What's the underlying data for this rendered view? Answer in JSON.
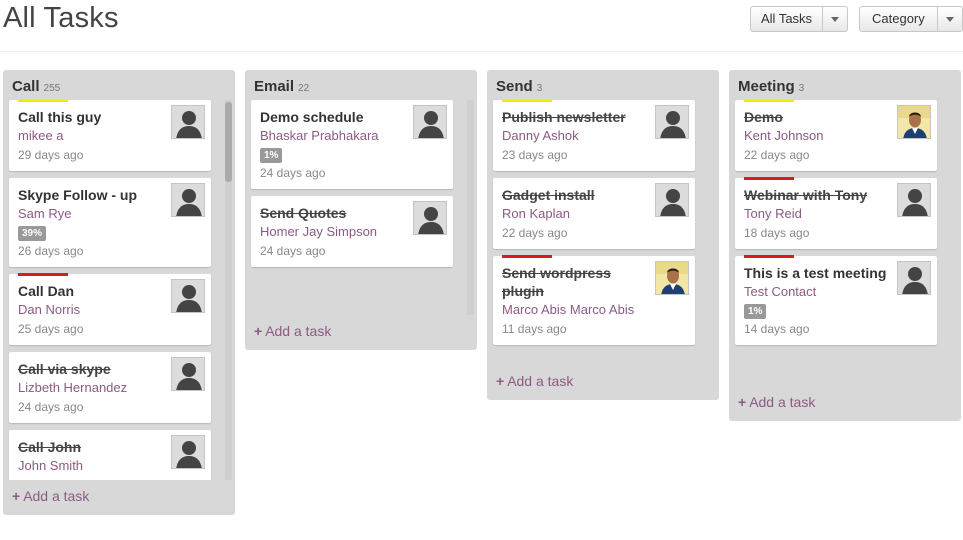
{
  "page": {
    "title": "All Tasks"
  },
  "filters": {
    "all_tasks_label": "All Tasks",
    "category_label": "Category"
  },
  "add_task_label": "Add a task",
  "columns": [
    {
      "name": "Call",
      "count": "255",
      "tasks": [
        {
          "title": "Call this guy",
          "contact": "mikee a",
          "time": "29 days ago",
          "priority": "yellow",
          "done": false,
          "progress": "",
          "avatar": "silhouette"
        },
        {
          "title": "Skype Follow - up",
          "contact": "Sam Rye",
          "time": "26 days ago",
          "priority": "",
          "done": false,
          "progress": "39%",
          "avatar": "silhouette"
        },
        {
          "title": "Call Dan",
          "contact": "Dan Norris",
          "time": "25 days ago",
          "priority": "red",
          "done": false,
          "progress": "",
          "avatar": "silhouette"
        },
        {
          "title": "Call via skype",
          "contact": "Lizbeth Hernandez",
          "time": "24 days ago",
          "priority": "",
          "done": true,
          "progress": "",
          "avatar": "silhouette"
        },
        {
          "title": "Call John",
          "contact": "John Smith",
          "time": "",
          "priority": "",
          "done": true,
          "progress": "",
          "avatar": "silhouette"
        }
      ]
    },
    {
      "name": "Email",
      "count": "22",
      "tasks": [
        {
          "title": "Demo schedule",
          "contact": "Bhaskar Prabhakara",
          "time": "24 days ago",
          "priority": "",
          "done": false,
          "progress": "1%",
          "avatar": "silhouette"
        },
        {
          "title": "Send Quotes",
          "contact": "Homer Jay Simpson",
          "time": "24 days ago",
          "priority": "",
          "done": true,
          "progress": "",
          "avatar": "silhouette"
        }
      ]
    },
    {
      "name": "Send",
      "count": "3",
      "tasks": [
        {
          "title": "Publish newsletter",
          "contact": "Danny Ashok",
          "time": "23 days ago",
          "priority": "yellow",
          "done": true,
          "progress": "",
          "avatar": "silhouette"
        },
        {
          "title": "Gadget install",
          "contact": "Ron Kaplan",
          "time": "22 days ago",
          "priority": "",
          "done": true,
          "progress": "",
          "avatar": "silhouette"
        },
        {
          "title": "Send wordpress plugin",
          "contact": "Marco Abis Marco Abis",
          "time": "11 days ago",
          "priority": "red",
          "done": true,
          "progress": "",
          "avatar": "photo"
        }
      ]
    },
    {
      "name": "Meeting",
      "count": "3",
      "tasks": [
        {
          "title": "Demo",
          "contact": "Kent Johnson",
          "time": "22 days ago",
          "priority": "yellow",
          "done": true,
          "progress": "",
          "avatar": "photo"
        },
        {
          "title": "Webinar with Tony",
          "contact": "Tony Reid",
          "time": "18 days ago",
          "priority": "red",
          "done": true,
          "progress": "",
          "avatar": "silhouette"
        },
        {
          "title": "This is a test meeting",
          "contact": "Test Contact",
          "time": "14 days ago",
          "priority": "red",
          "done": false,
          "progress": "1%",
          "avatar": "silhouette"
        }
      ]
    }
  ],
  "colors": {
    "contact": "#8c5a84",
    "priority_yellow": "#f4e800",
    "priority_red": "#d81c1c",
    "column_bg": "#d8d8d8"
  }
}
